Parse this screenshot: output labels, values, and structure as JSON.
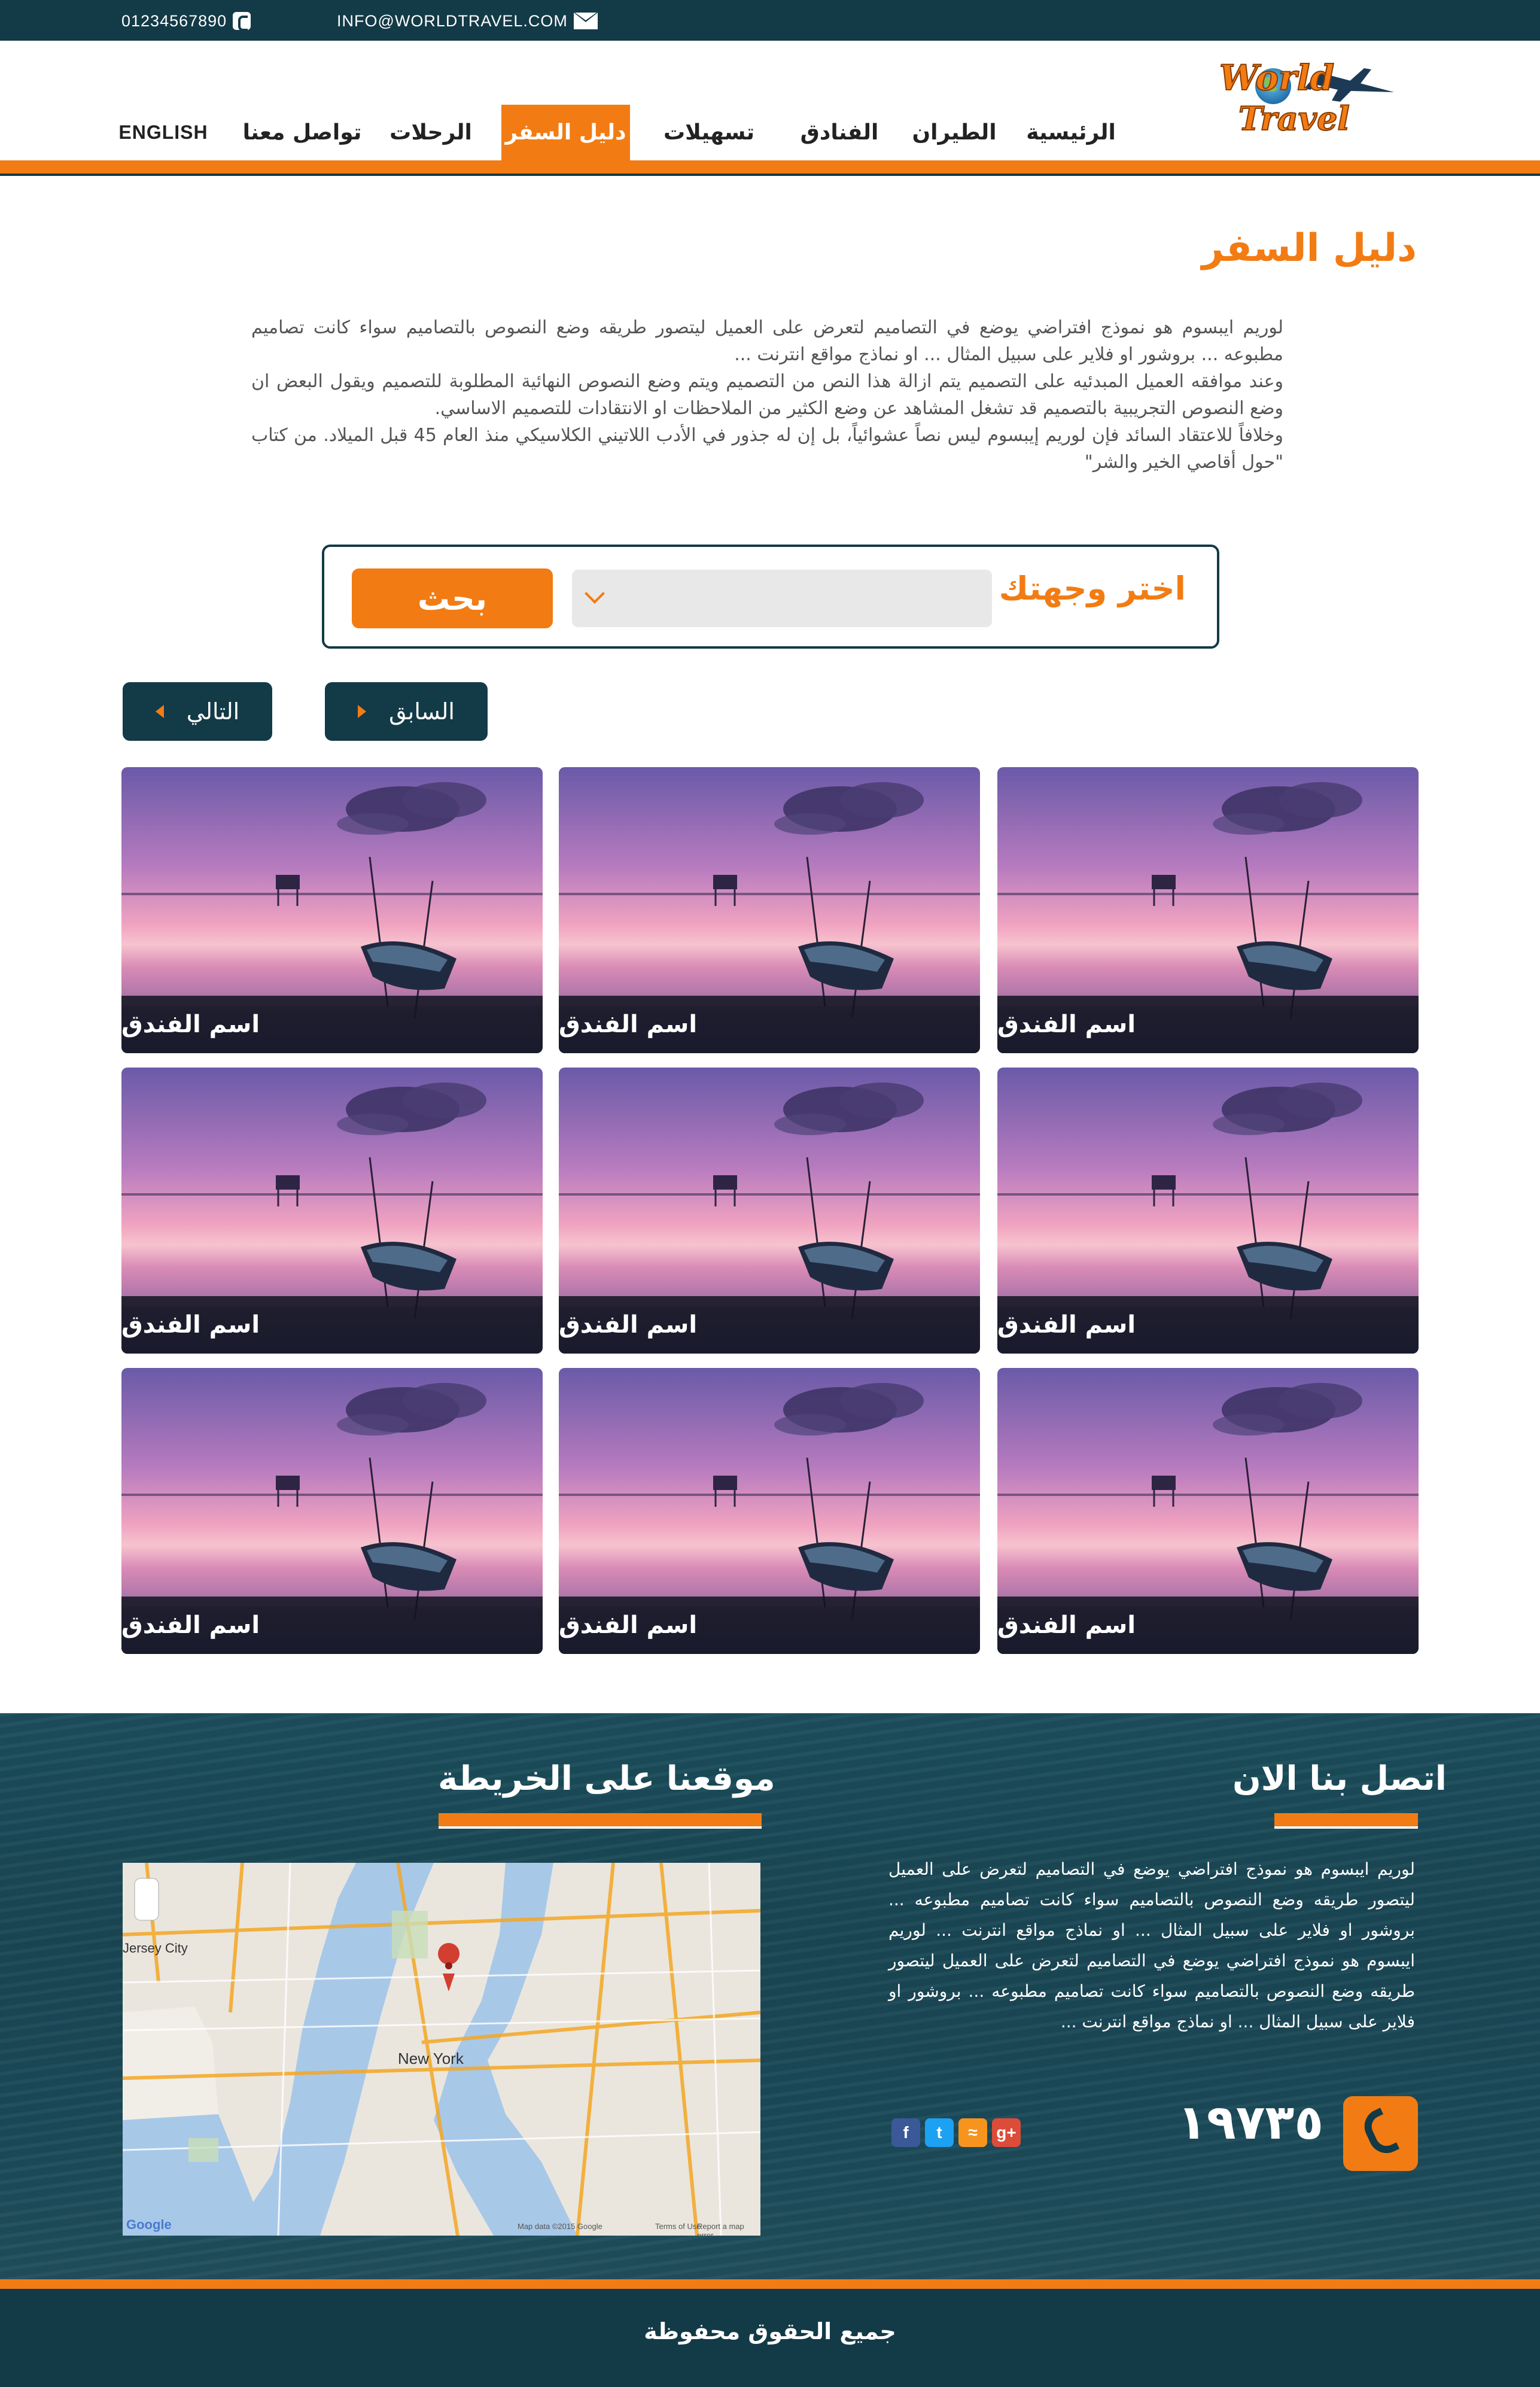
{
  "topbar": {
    "phone": "01234567890",
    "email": "INFO@WORLDTRAVEL.COM"
  },
  "brand": {
    "logo_line1": "World",
    "logo_line2": "Travel"
  },
  "nav": {
    "items": [
      {
        "label": "الرئيسية"
      },
      {
        "label": "الطيران"
      },
      {
        "label": "الفنادق"
      },
      {
        "label": "تسهيلات"
      },
      {
        "label": "دليل السفر"
      },
      {
        "label": "الرحلات"
      },
      {
        "label": "تواصل معنا"
      },
      {
        "label": "ENGLISH"
      }
    ],
    "active": "دليل السفر"
  },
  "page": {
    "title": "دليل السفر",
    "intro": [
      "لوريم ايبسوم هو نموذج افتراضي يوضع في التصاميم لتعرض على العميل ليتصور طريقه وضع النصوص بالتصاميم سواء كانت تصاميم مطبوعه ... بروشور او فلاير على سبيل المثال ... او نماذج مواقع انترنت ...",
      "وعند موافقه العميل المبدئيه على التصميم يتم ازالة هذا النص من التصميم ويتم وضع النصوص النهائية المطلوبة للتصميم ويقول البعض ان وضع النصوص التجريبية بالتصميم قد تشغل المشاهد عن وضع الكثير من الملاحظات او الانتقادات للتصميم الاساسي.",
      "وخلافاً للاعتقاد السائد فإن لوريم إيبسوم ليس نصاً عشوائياً، بل إن له جذور في الأدب اللاتيني الكلاسيكي منذ العام 45 قبل الميلاد. من كتاب \"حول أقاصي الخير والشر\""
    ]
  },
  "search": {
    "label": "اختر وجهتك",
    "selected": "",
    "button": "بحث"
  },
  "pager": {
    "prev": "السابق",
    "next": "التالي"
  },
  "hotels": [
    {
      "name": "اسم الفندق"
    },
    {
      "name": "اسم الفندق"
    },
    {
      "name": "اسم الفندق"
    },
    {
      "name": "اسم الفندق"
    },
    {
      "name": "اسم الفندق"
    },
    {
      "name": "اسم الفندق"
    },
    {
      "name": "اسم الفندق"
    },
    {
      "name": "اسم الفندق"
    },
    {
      "name": "اسم الفندق"
    }
  ],
  "footer": {
    "contact_title": "اتصل بنا الان",
    "map_title": "موقعنا على الخريطة",
    "contact_text": "لوريم ايبسوم هو نموذج افتراضي يوضع في التصاميم لتعرض على العميل ليتصور طريقه وضع النصوص بالتصاميم سواء كانت تصاميم مطبوعه ... بروشور او فلاير على سبيل المثال ... او نماذج مواقع انترنت ... لوريم ايبسوم هو نموذج افتراضي يوضع في التصاميم لتعرض على العميل ليتصور طريقه وضع النصوص بالتصاميم سواء كانت تصاميم مطبوعه ... بروشور او فلاير على سبيل المثال ... او نماذج مواقع انترنت ...",
    "hotline": "١٩٧٣٥",
    "social": [
      {
        "icon": "facebook-icon",
        "glyph": "f",
        "color": "#3b5998"
      },
      {
        "icon": "twitter-icon",
        "glyph": "t",
        "color": "#1da1f2"
      },
      {
        "icon": "rss-icon",
        "glyph": "≈",
        "color": "#f7941d"
      },
      {
        "icon": "googleplus-icon",
        "glyph": "g+",
        "color": "#dd4b39"
      }
    ],
    "map_labels": {
      "city": "New York",
      "jersey": "Jersey City",
      "google": "Google",
      "credit": "Map data ©2015 Google",
      "terms": "Terms of Use",
      "report": "Report a map error"
    },
    "copyright": "جميع الحقوق محفوظة"
  },
  "colors": {
    "primary": "#133a47",
    "accent": "#f27c13"
  }
}
